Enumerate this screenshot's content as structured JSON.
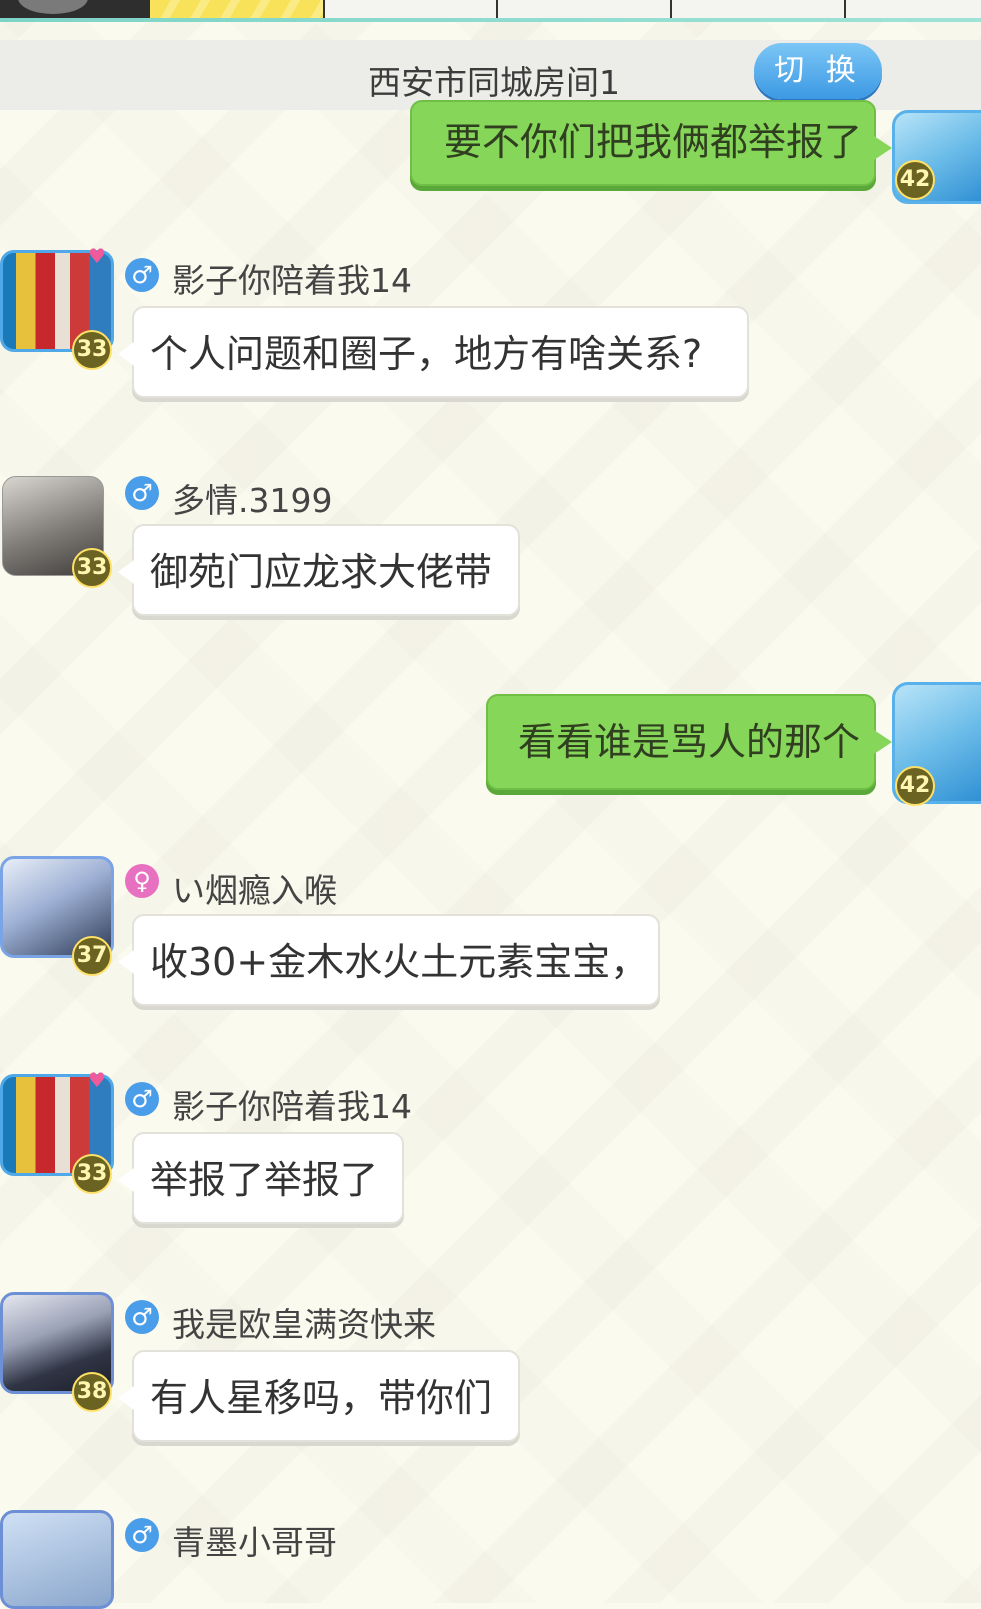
{
  "room": {
    "title": "西安市同城房间1",
    "switch_label": "切 换"
  },
  "messages": [
    {
      "side": "right",
      "text": "要不你们把我俩都举报了",
      "level": "42"
    },
    {
      "side": "left",
      "name": "影子你陪着我14",
      "gender": "male",
      "level": "33",
      "text": "个人问题和圈子，地方有啥关系?"
    },
    {
      "side": "left",
      "name": "多情.3199",
      "gender": "male",
      "level": "33",
      "text": "御苑门应龙求大佬带"
    },
    {
      "side": "right",
      "text": "看看谁是骂人的那个",
      "level": "42"
    },
    {
      "side": "left",
      "name": "い烟瘾入喉",
      "gender": "female",
      "level": "37",
      "text": "收30+金木水火土元素宝宝，"
    },
    {
      "side": "left",
      "name": "影子你陪着我14",
      "gender": "male",
      "level": "33",
      "text": "举报了举报了"
    },
    {
      "side": "left",
      "name": "我是欧皇满资快来",
      "gender": "male",
      "level": "38",
      "text": "有人星移吗，带你们"
    },
    {
      "side": "left",
      "name": "青墨小哥哥",
      "gender": "male",
      "level": ""
    }
  ],
  "icons": {
    "male": "♂",
    "female": "♀",
    "heart": "♥"
  }
}
